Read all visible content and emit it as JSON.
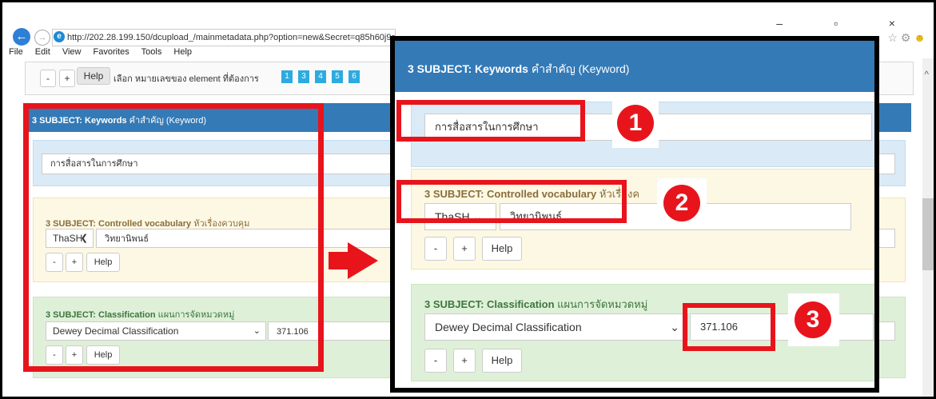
{
  "browser": {
    "url": "http://202.28.199.150/dcupload_/mainmetadata.php?option=new&Secret=q85h60j9gg9",
    "menu": [
      "File",
      "Edit",
      "View",
      "Favorites",
      "Tools",
      "Help"
    ],
    "window_controls": "– ▫ ×",
    "right_icons": "☆ ⚙"
  },
  "toolbar": {
    "minus": "-",
    "plus": "+",
    "help": "Help",
    "text": "เลือก หมายเลขของ element ที่ต้องการ",
    "numbers": [
      "1",
      "3",
      "4",
      "5",
      "6"
    ]
  },
  "main": {
    "header_title_bold": "3 SUBJECT: Keywords",
    "header_title_thai": "คำสำคัญ (Keyword)",
    "keyword_value": "การสื่อสารในการศึกษา",
    "cv_title_bold": "3 SUBJECT: Controlled vocabulary",
    "cv_title_thai": "หัวเรื่องควบคุม",
    "cv_select": "ThaSH",
    "cv_value": "วิทยานิพนธ์",
    "cl_title_bold": "3 SUBJECT: Classification",
    "cl_title_thai": "แผนการจัดหมวดหมู่",
    "cl_select": "Dewey Decimal Classification",
    "cl_value": "371.106",
    "btn_minus": "-",
    "btn_plus": "+",
    "btn_help": "Help"
  },
  "zoom": {
    "header_title_bold": "3 SUBJECT: Keywords",
    "header_title_thai": "คำสำคัญ (Keyword)",
    "keyword_value": "การสื่อสารในการศึกษา",
    "cv_title_bold": "3 SUBJECT: Controlled vocabulary",
    "cv_title_thai": "หัวเรื่องค",
    "cv_select": "ThaSH",
    "cv_value": "วิทยานิพนธ์",
    "cl_title_bold": "3 SUBJECT: Classification",
    "cl_title_thai": "แผนการจัดหมวดหมู่",
    "cl_select": "Dewey Decimal Classification",
    "cl_value": "371.106",
    "btn_minus": "-",
    "btn_plus": "+",
    "btn_help": "Help",
    "badges": [
      "1",
      "2",
      "3"
    ]
  },
  "colors": {
    "highlight_red": "#e8141c",
    "header_blue": "#337ab7",
    "nav_number_blue": "#2dabe0"
  }
}
